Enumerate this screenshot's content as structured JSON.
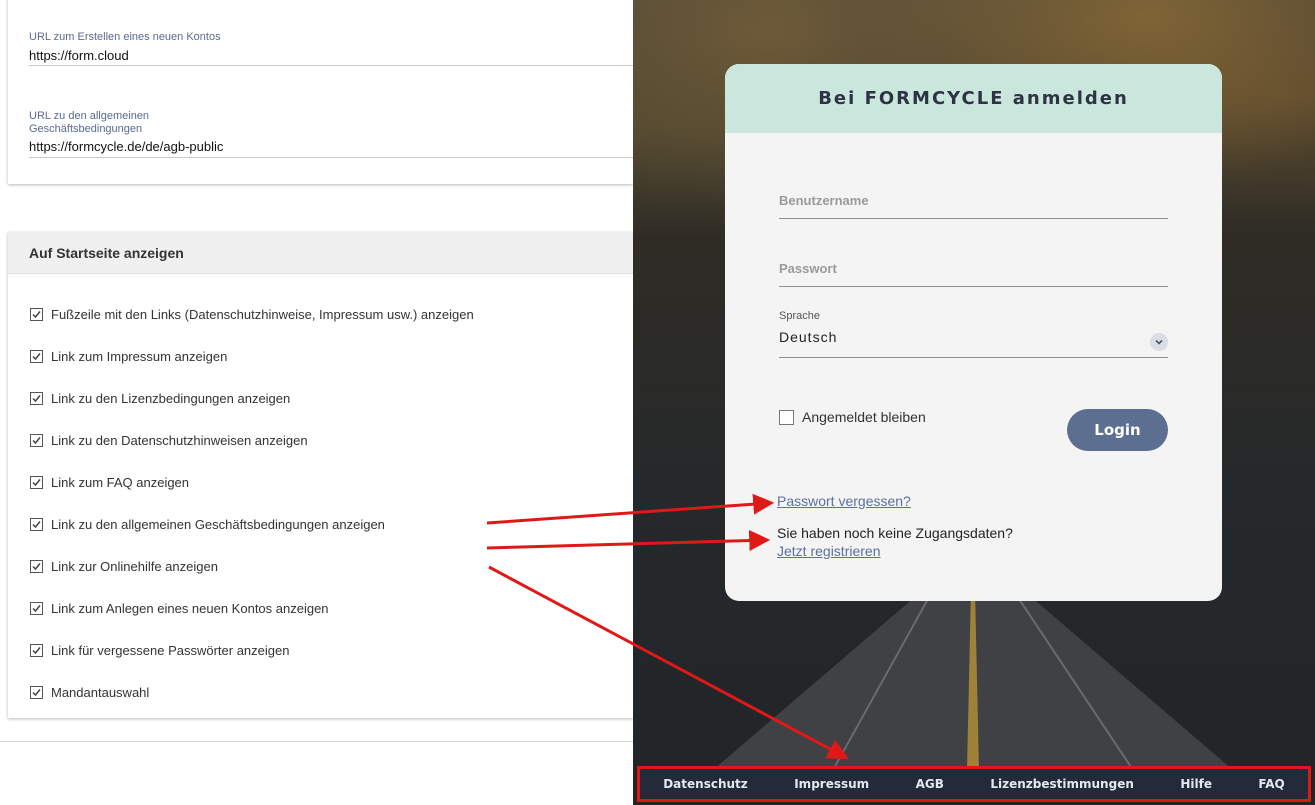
{
  "settings": {
    "new_account_url": {
      "label": "URL zum Erstellen eines neuen Kontos",
      "value": "https://form.cloud"
    },
    "terms_url": {
      "label_line1": "URL zu den allgemeinen",
      "label_line2": "Geschäftsbedingungen",
      "value": "https://formcycle.de/de/agb-public"
    },
    "section_title": "Auf Startseite anzeigen",
    "options": [
      {
        "label": "Fußzeile mit den Links (Datenschutzhinweise, Impressum usw.) anzeigen",
        "checked": true
      },
      {
        "label": "Link zum Impressum anzeigen",
        "checked": true
      },
      {
        "label": "Link zu den Lizenzbedingungen anzeigen",
        "checked": true
      },
      {
        "label": "Link zu den Datenschutzhinweisen anzeigen",
        "checked": true
      },
      {
        "label": "Link zum FAQ anzeigen",
        "checked": true
      },
      {
        "label": "Link zu den allgemeinen Geschäftsbedingungen anzeigen",
        "checked": true
      },
      {
        "label": "Link zur Onlinehilfe anzeigen",
        "checked": true
      },
      {
        "label": "Link zum Anlegen eines neuen Kontos anzeigen",
        "checked": true
      },
      {
        "label": "Link für vergessene Passwörter anzeigen",
        "checked": true
      },
      {
        "label": "Mandantauswahl",
        "checked": true
      }
    ]
  },
  "login": {
    "title": "Bei FORMCYCLE anmelden",
    "username_placeholder": "Benutzername",
    "password_placeholder": "Passwort",
    "language_label": "Sprache",
    "language_value": "Deutsch",
    "remember_label": "Angemeldet bleiben",
    "login_button": "Login",
    "forgot_link": "Passwort vergessen?",
    "no_account_text": "Sie haben noch keine Zugangsdaten?",
    "register_link": "Jetzt registrieren"
  },
  "footer_links": [
    "Datenschutz",
    "Impressum",
    "AGB",
    "Lizenzbestimmungen",
    "Hilfe",
    "FAQ"
  ],
  "colors": {
    "login_header": "#cbe7dd",
    "login_button": "#5c6f90",
    "footer_bg": "#232b3a",
    "highlight_red": "#e01818",
    "link": "#5a6fa0"
  }
}
